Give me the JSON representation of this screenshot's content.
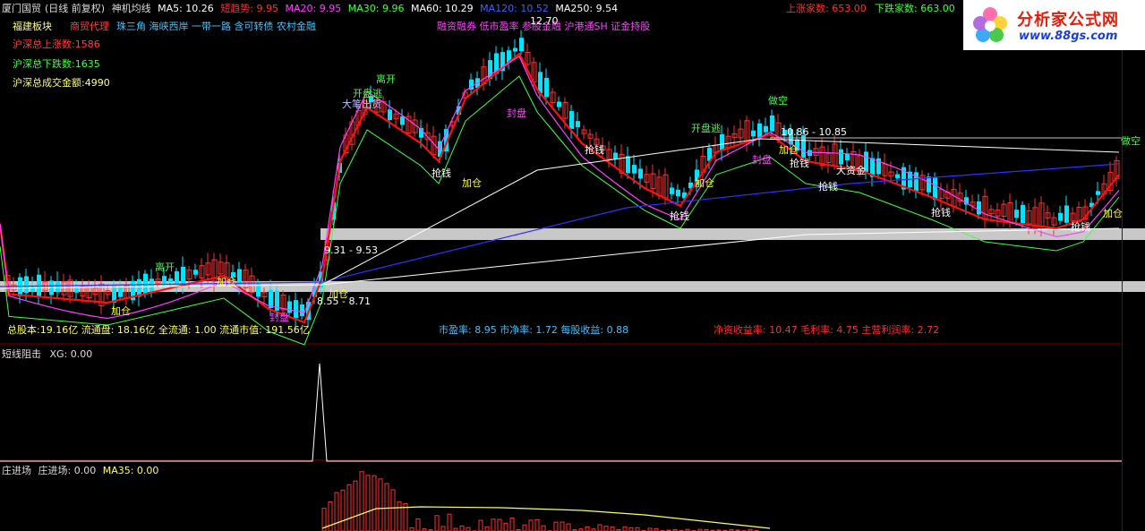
{
  "header": {
    "stock_name": "厦门国贸",
    "mode": "(日线 前复权)",
    "indicator": "神机均线",
    "ma_items": [
      {
        "label": "MA5: 10.26",
        "color": "#ffffff"
      },
      {
        "label": "短趋势: 9.95",
        "color": "#ff3030"
      },
      {
        "label": "MA20: 9.95",
        "color": "#ff40ff"
      },
      {
        "label": "MA30: 9.96",
        "color": "#40ff40"
      },
      {
        "label": "MA60: 10.29",
        "color": "#ffffff"
      },
      {
        "label": "MA120: 10.52",
        "color": "#3030ff"
      },
      {
        "label": "MA250: 9.54",
        "color": "#ffffff"
      }
    ]
  },
  "market": {
    "up_count": "上涨家数: 653.00",
    "down_count": "下跌家数: 663.00"
  },
  "sectors": {
    "primary": {
      "label": "福建板块",
      "color": "#ffff80"
    },
    "secondary": {
      "label": "商贸代理",
      "color": "#ff4040"
    },
    "tags": "珠三角 海峡西岸 一带一路 含可转债 农村金融",
    "concepts": "融资融券 低市盈率 参股金融 沪港通SH 证金持股"
  },
  "market_stats": {
    "up": "沪深总上涨数:1586",
    "down": "沪深总下跌数:1635",
    "amount": "沪深总成交金额:4990"
  },
  "finance": {
    "capital": "总股本:19.16亿 流通盘: 18.16亿 全流通: 1.00 流通市值: 191.56亿",
    "valuation": "市盈率: 8.95 市净率: 1.72 每股收益: 0.88",
    "profit": "净资收益率: 10.47 毛利率: 4.75 主营利润率: 2.72"
  },
  "annotations": {
    "peak_price": "12.70",
    "band1": "9.31 - 9.53",
    "band2": "8.55 - 8.71",
    "band3": "10.86 - 10.85",
    "signals": [
      {
        "text": "离开",
        "color": "#40ff40"
      },
      {
        "text": "开盘逃",
        "color": "#40ff40"
      },
      {
        "text": "大笔出货",
        "color": "#c0c0ff"
      },
      {
        "text": "抢钱",
        "color": "#ffffff"
      },
      {
        "text": "加仓",
        "color": "#ffff40"
      },
      {
        "text": "封盘",
        "color": "#ff40ff"
      },
      {
        "text": "做空",
        "color": "#40ff40"
      },
      {
        "text": "大资金",
        "color": "#ffffff"
      }
    ]
  },
  "panel2": {
    "title": "短线阻击",
    "value": "XG: 0.00"
  },
  "panel3": {
    "title": "庄进场",
    "value": "庄进场: 0.00",
    "ma": "MA35: 0.00"
  },
  "logo": {
    "name": "分析家公式网",
    "url": "www.88gs.com"
  },
  "colors": {
    "background": "#000000",
    "up": "#ff3030",
    "down": "#00ffff",
    "ma_short": "#ff2020"
  }
}
